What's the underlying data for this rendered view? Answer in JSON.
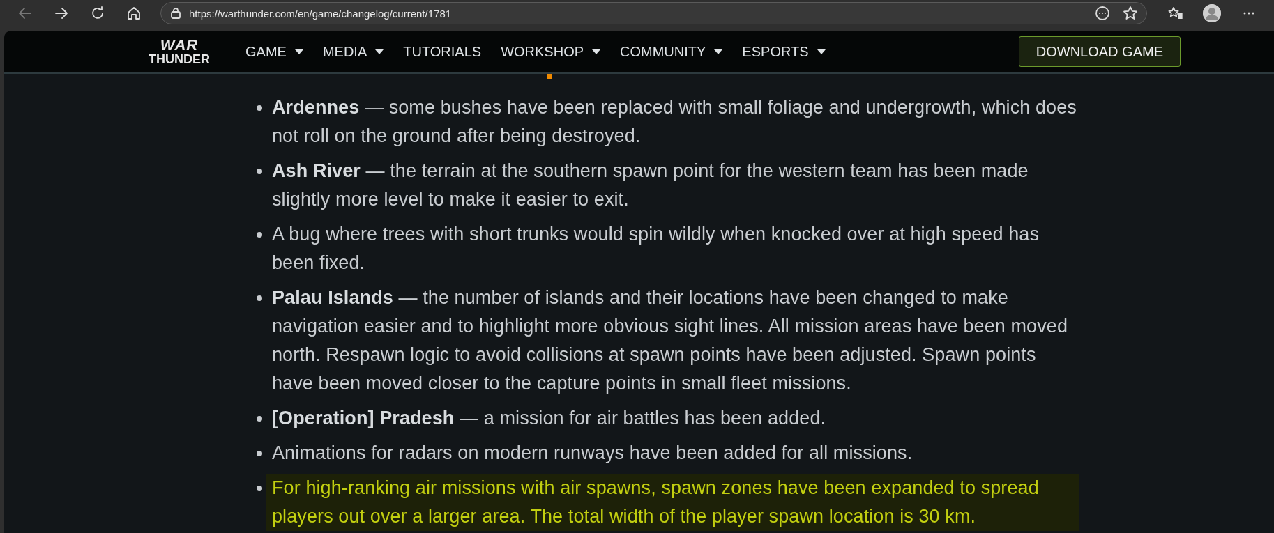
{
  "browser": {
    "url": "https://warthunder.com/en/game/changelog/current/1781",
    "back_disabled": true
  },
  "logo": {
    "top": "WAR",
    "bottom": "THUNDER"
  },
  "nav": {
    "menu": [
      {
        "label": "GAME",
        "dropdown": true
      },
      {
        "label": "MEDIA",
        "dropdown": true
      },
      {
        "label": "TUTORIALS",
        "dropdown": false
      },
      {
        "label": "WORKSHOP",
        "dropdown": true
      },
      {
        "label": "COMMUNITY",
        "dropdown": true
      },
      {
        "label": "ESPORTS",
        "dropdown": true
      }
    ],
    "download_button": "DOWNLOAD GAME"
  },
  "section": {
    "items": [
      {
        "text": "**Ardennes** — some bushes have been replaced with small foliage and undergrowth, which does not roll on the ground after being destroyed.",
        "highlighted": false
      },
      {
        "text": "**Ash River** — the terrain at the southern spawn point for the western team has been made slightly more level to make it easier to exit.",
        "highlighted": false
      },
      {
        "text": "A bug where trees with short trunks would spin wildly when knocked over at high speed has been fixed.",
        "highlighted": false
      },
      {
        "text": "**Palau Islands** — the number of islands and their locations have been changed to make navigation easier and to highlight more obvious sight lines. All mission areas have been moved north. Respawn logic to avoid collisions at spawn points have been adjusted. Spawn points have been moved closer to the capture points in small fleet missions.",
        "highlighted": false
      },
      {
        "text": "**[Operation] Pradesh** — a mission for air battles has been added.",
        "highlighted": false
      },
      {
        "text": "Animations for radars on modern runways have been added for all missions.",
        "highlighted": false
      },
      {
        "text": "For high-ranking air missions with air spawns, spawn zones have been expanded to spread players out over a larger area. The total width of the player spawn location is 30 km.",
        "highlighted": true
      }
    ]
  }
}
